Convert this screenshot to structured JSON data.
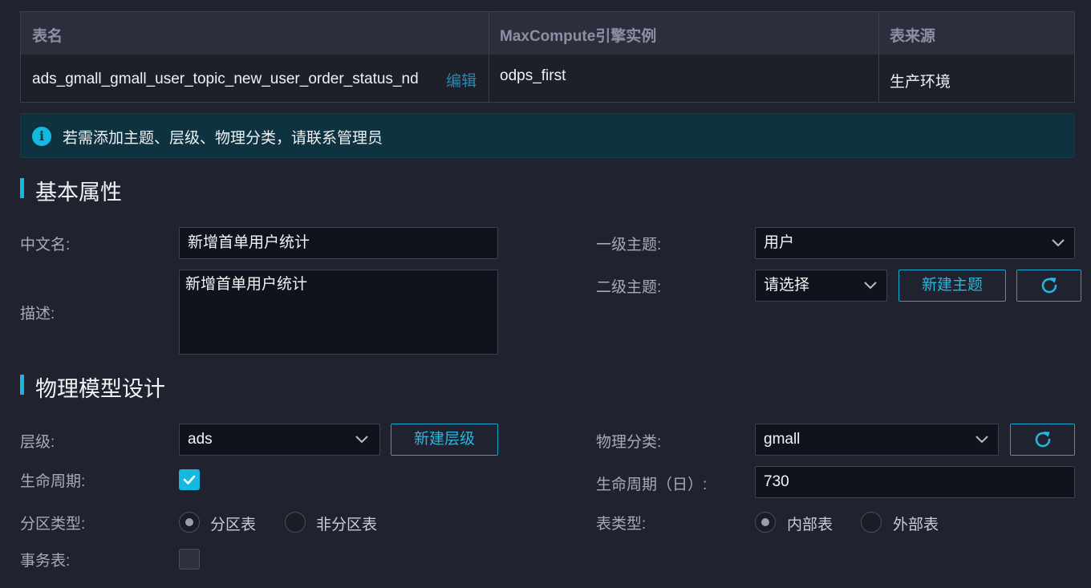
{
  "table": {
    "headers": [
      "表名",
      "MaxCompute引擎实例",
      "表来源"
    ],
    "row": {
      "table_name": "ads_gmall_gmall_user_topic_new_user_order_status_nd",
      "edit_link": "编辑",
      "engine_instance": "odps_first",
      "source": "生产环境"
    }
  },
  "notice": {
    "icon": "info-icon",
    "text": "若需添加主题、层级、物理分类，请联系管理员"
  },
  "basic_section": {
    "title": "基本属性",
    "cn_name_label": "中文名:",
    "cn_name_value": "新增首单用户统计",
    "desc_label": "描述:",
    "desc_value": "新增首单用户统计",
    "topic1_label": "一级主题:",
    "topic1_value": "用户",
    "topic2_label": "二级主题:",
    "topic2_value": "请选择",
    "new_topic_button": "新建主题"
  },
  "physical_section": {
    "title": "物理模型设计",
    "layer_label": "层级:",
    "layer_value": "ads",
    "new_layer_button": "新建层级",
    "category_label": "物理分类:",
    "category_value": "gmall",
    "lifecycle_label": "生命周期:",
    "lifecycle_checked": true,
    "lifecycle_days_label": "生命周期（日）:",
    "lifecycle_days_value": "730",
    "partition_type_label": "分区类型:",
    "partition_options": [
      "分区表",
      "非分区表"
    ],
    "partition_selected": "分区表",
    "table_type_label": "表类型:",
    "table_type_options": [
      "内部表",
      "外部表"
    ],
    "table_type_selected": "内部表",
    "transaction_label": "事务表:",
    "transaction_checked": false
  },
  "colors": {
    "accent": "#14b9e0",
    "background": "#20222f",
    "link": "#2f86b3"
  }
}
